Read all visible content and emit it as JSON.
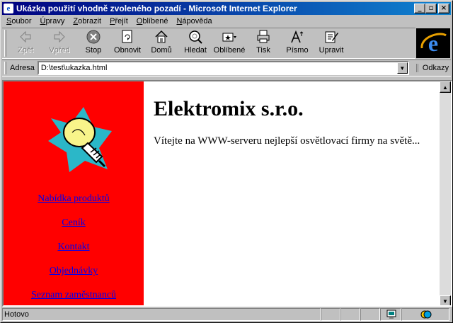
{
  "window": {
    "title": "Ukázka použití vhodně zvoleného pozadí - Microsoft Internet Explorer"
  },
  "menu": [
    {
      "pre": "",
      "acc": "S",
      "post": "oubor"
    },
    {
      "pre": "",
      "acc": "Ú",
      "post": "pravy"
    },
    {
      "pre": "",
      "acc": "Z",
      "post": "obrazit"
    },
    {
      "pre": "",
      "acc": "P",
      "post": "řejít"
    },
    {
      "pre": "",
      "acc": "O",
      "post": "blíbené"
    },
    {
      "pre": "",
      "acc": "N",
      "post": "ápověda"
    }
  ],
  "toolbar": {
    "back": "Zpět",
    "forward": "Vpřed",
    "stop": "Stop",
    "refresh": "Obnovit",
    "home": "Domů",
    "search": "Hledat",
    "favorites": "Oblíbené",
    "print": "Tisk",
    "font": "Písmo",
    "edit": "Upravit"
  },
  "address": {
    "label": "Adresa",
    "value": "D:\\test\\ukazka.html",
    "links": "Odkazy"
  },
  "page": {
    "heading": "Elektromix s.r.o.",
    "welcome": "Vítejte na WWW-serveru nejlepší osvětlovací firmy na světě...",
    "nav": [
      "Nabídka produktů",
      "Ceník",
      "Kontakt",
      "Objednávky",
      "Seznam zaměstnanců"
    ],
    "sidebar_color": "#ff0000",
    "link_color": "#0000ee"
  },
  "status": {
    "text": "Hotovo"
  }
}
